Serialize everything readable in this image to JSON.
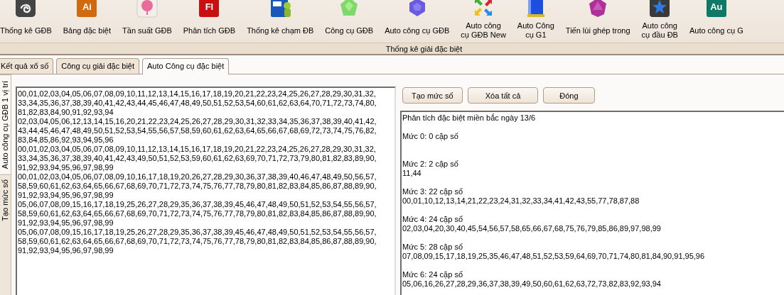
{
  "toolbar": {
    "items": [
      {
        "label": "Thống kê GĐB"
      },
      {
        "label": "Bảng đặc biệt",
        "icon_text": "Ai"
      },
      {
        "label": "Tần suất GĐB"
      },
      {
        "label": "Phân tích GĐB",
        "icon_text": "Fl"
      },
      {
        "label": "Thống kê chạm ĐB"
      },
      {
        "label": "Công cụ GĐB"
      },
      {
        "label": "Auto công cụ GĐB"
      },
      {
        "label": "Auto công\ncụ GĐB New"
      },
      {
        "label": "Auto Công\ncụ G1"
      },
      {
        "label": "Tiến lùi ghép trong"
      },
      {
        "label": "Auto công\ncụ đầu ĐB"
      },
      {
        "label": "Auto công cụ G",
        "icon_text": "Au"
      }
    ],
    "group_label": "Thống kê giải đặc biệt"
  },
  "tabs": [
    {
      "label": "Kết quả xổ số",
      "selected": false
    },
    {
      "label": "Công cụ giải đặc biệt",
      "selected": false
    },
    {
      "label": "Auto Công cụ đặc biệt",
      "selected": true
    }
  ],
  "side_tabs": [
    {
      "label": "Auto công cụ GĐB 1 vị trí",
      "selected": true
    },
    {
      "label": "Tạo mức số",
      "selected": false
    }
  ],
  "input_text": {
    "lines": [
      "00,01,02,03,04,05,06,07,08,09,10,11,12,13,14,15,16,17,18,19,20,21,22,23,24,25,26,27,28,29,30,31,32,",
      "33,34,35,36,37,38,39,40,41,42,43,44,45,46,47,48,49,50,51,52,53,54,60,61,62,63,64,70,71,72,73,74,80,",
      "81,82,83,84,90,91,92,93,94",
      "02,03,04,05,06,12,13,14,15,16,20,21,22,23,24,25,26,27,28,29,30,31,32,33,34,35,36,37,38,39,40,41,42,",
      "43,44,45,46,47,48,49,50,51,52,53,54,55,56,57,58,59,60,61,62,63,64,65,66,67,68,69,72,73,74,75,76,82,",
      "83,84,85,86,92,93,94,95,96",
      "00,01,02,03,04,05,06,07,08,09,10,11,12,13,14,15,16,17,18,19,20,21,22,23,24,25,26,27,28,29,30,31,32,",
      "33,34,35,36,37,38,39,40,41,42,43,49,50,51,52,53,59,60,61,62,63,69,70,71,72,73,79,80,81,82,83,89,90,",
      "91,92,93,94,95,96,97,98,99",
      "00,01,02,03,04,05,06,07,08,09,10,16,17,18,19,20,26,27,28,29,30,36,37,38,39,40,46,47,48,49,50,56,57,",
      "58,59,60,61,62,63,64,65,66,67,68,69,70,71,72,73,74,75,76,77,78,79,80,81,82,83,84,85,86,87,88,89,90,",
      "91,92,93,94,95,96,97,98,99",
      "05,06,07,08,09,15,16,17,18,19,25,26,27,28,29,35,36,37,38,39,45,46,47,48,49,50,51,52,53,54,55,56,57,",
      "58,59,60,61,62,63,64,65,66,67,68,69,70,71,72,73,74,75,76,77,78,79,80,81,82,83,84,85,86,87,88,89,90,",
      "91,92,93,94,95,96,97,98,99",
      "05,06,07,08,09,15,16,17,18,19,25,26,27,28,29,35,36,37,38,39,45,46,47,48,49,50,51,52,53,54,55,56,57,",
      "58,59,60,61,62,63,64,65,66,67,68,69,70,71,72,73,74,75,76,77,78,79,80,81,82,83,84,85,86,87,88,89,90,",
      "91,92,93,94,95,96,97,98,99"
    ]
  },
  "buttons": [
    "Tạo mức số",
    "Xóa tất cả",
    "Đóng"
  ],
  "output": {
    "title": "Phân tích đặc biệt miền bắc ngày 13/6",
    "levels": [
      {
        "heading": "Mức 0: 0 cặp số"
      },
      {
        "heading": "Mức 2: 2 cặp số",
        "numbers": "11,44"
      },
      {
        "heading": "Mức 3: 22 cặp số",
        "numbers": "00,01,10,12,13,14,21,22,23,24,31,32,33,34,41,42,43,55,77,78,87,88"
      },
      {
        "heading": "Mức 4: 24 cặp số",
        "numbers": "02,03,04,20,30,40,45,54,56,57,58,65,66,67,68,75,76,79,85,86,89,97,98,99"
      },
      {
        "heading": "Mức 5: 28 cặp số",
        "numbers": "07,08,09,15,17,18,19,25,35,46,47,48,51,52,53,59,64,69,70,71,74,80,81,84,90,91,95,96"
      },
      {
        "heading": "Mức 6: 24 cặp số",
        "numbers": "05,06,16,26,27,28,29,36,37,38,39,49,50,60,61,62,63,72,73,82,83,92,93,94"
      }
    ]
  }
}
